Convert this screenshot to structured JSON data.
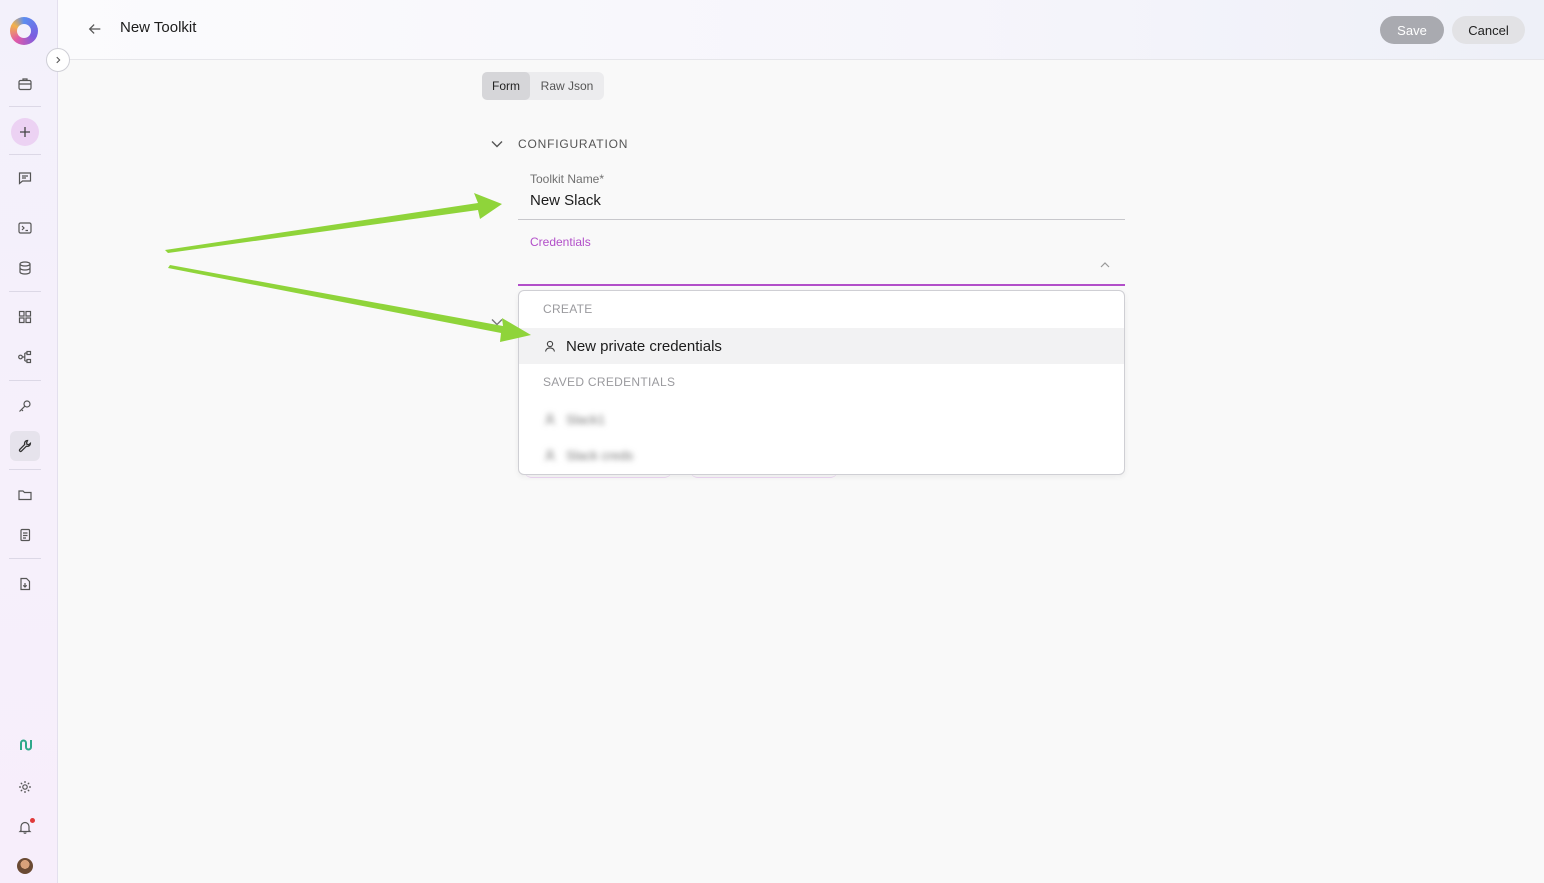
{
  "header": {
    "title": "New Toolkit",
    "save_label": "Save",
    "cancel_label": "Cancel"
  },
  "tabs": [
    {
      "label": "Form",
      "active": true
    },
    {
      "label": "Raw Json",
      "active": false
    }
  ],
  "section": {
    "title": "CONFIGURATION"
  },
  "fields": {
    "toolkit_name": {
      "label": "Toolkit Name*",
      "value": "New Slack"
    },
    "credentials": {
      "label": "Credentials",
      "value": ""
    }
  },
  "dropdown": {
    "create_group": "CREATE",
    "new_private_label": "New private credentials",
    "saved_group": "SAVED CREDENTIALS",
    "saved_items": [
      "Slack1",
      "Slack creds"
    ]
  },
  "sidebar": {
    "items": [
      "briefcase-icon",
      "add-icon",
      "chat-icon",
      "terminal-icon",
      "database-icon",
      "apps-icon",
      "flow-icon",
      "key-icon",
      "wrench-icon",
      "folder-icon",
      "documents-icon",
      "file-download-icon",
      "integrations-icon",
      "settings-icon",
      "bell-icon",
      "avatar"
    ]
  },
  "colors": {
    "accent": "#b24fc9",
    "annotation_arrow": "#8fd43a"
  }
}
